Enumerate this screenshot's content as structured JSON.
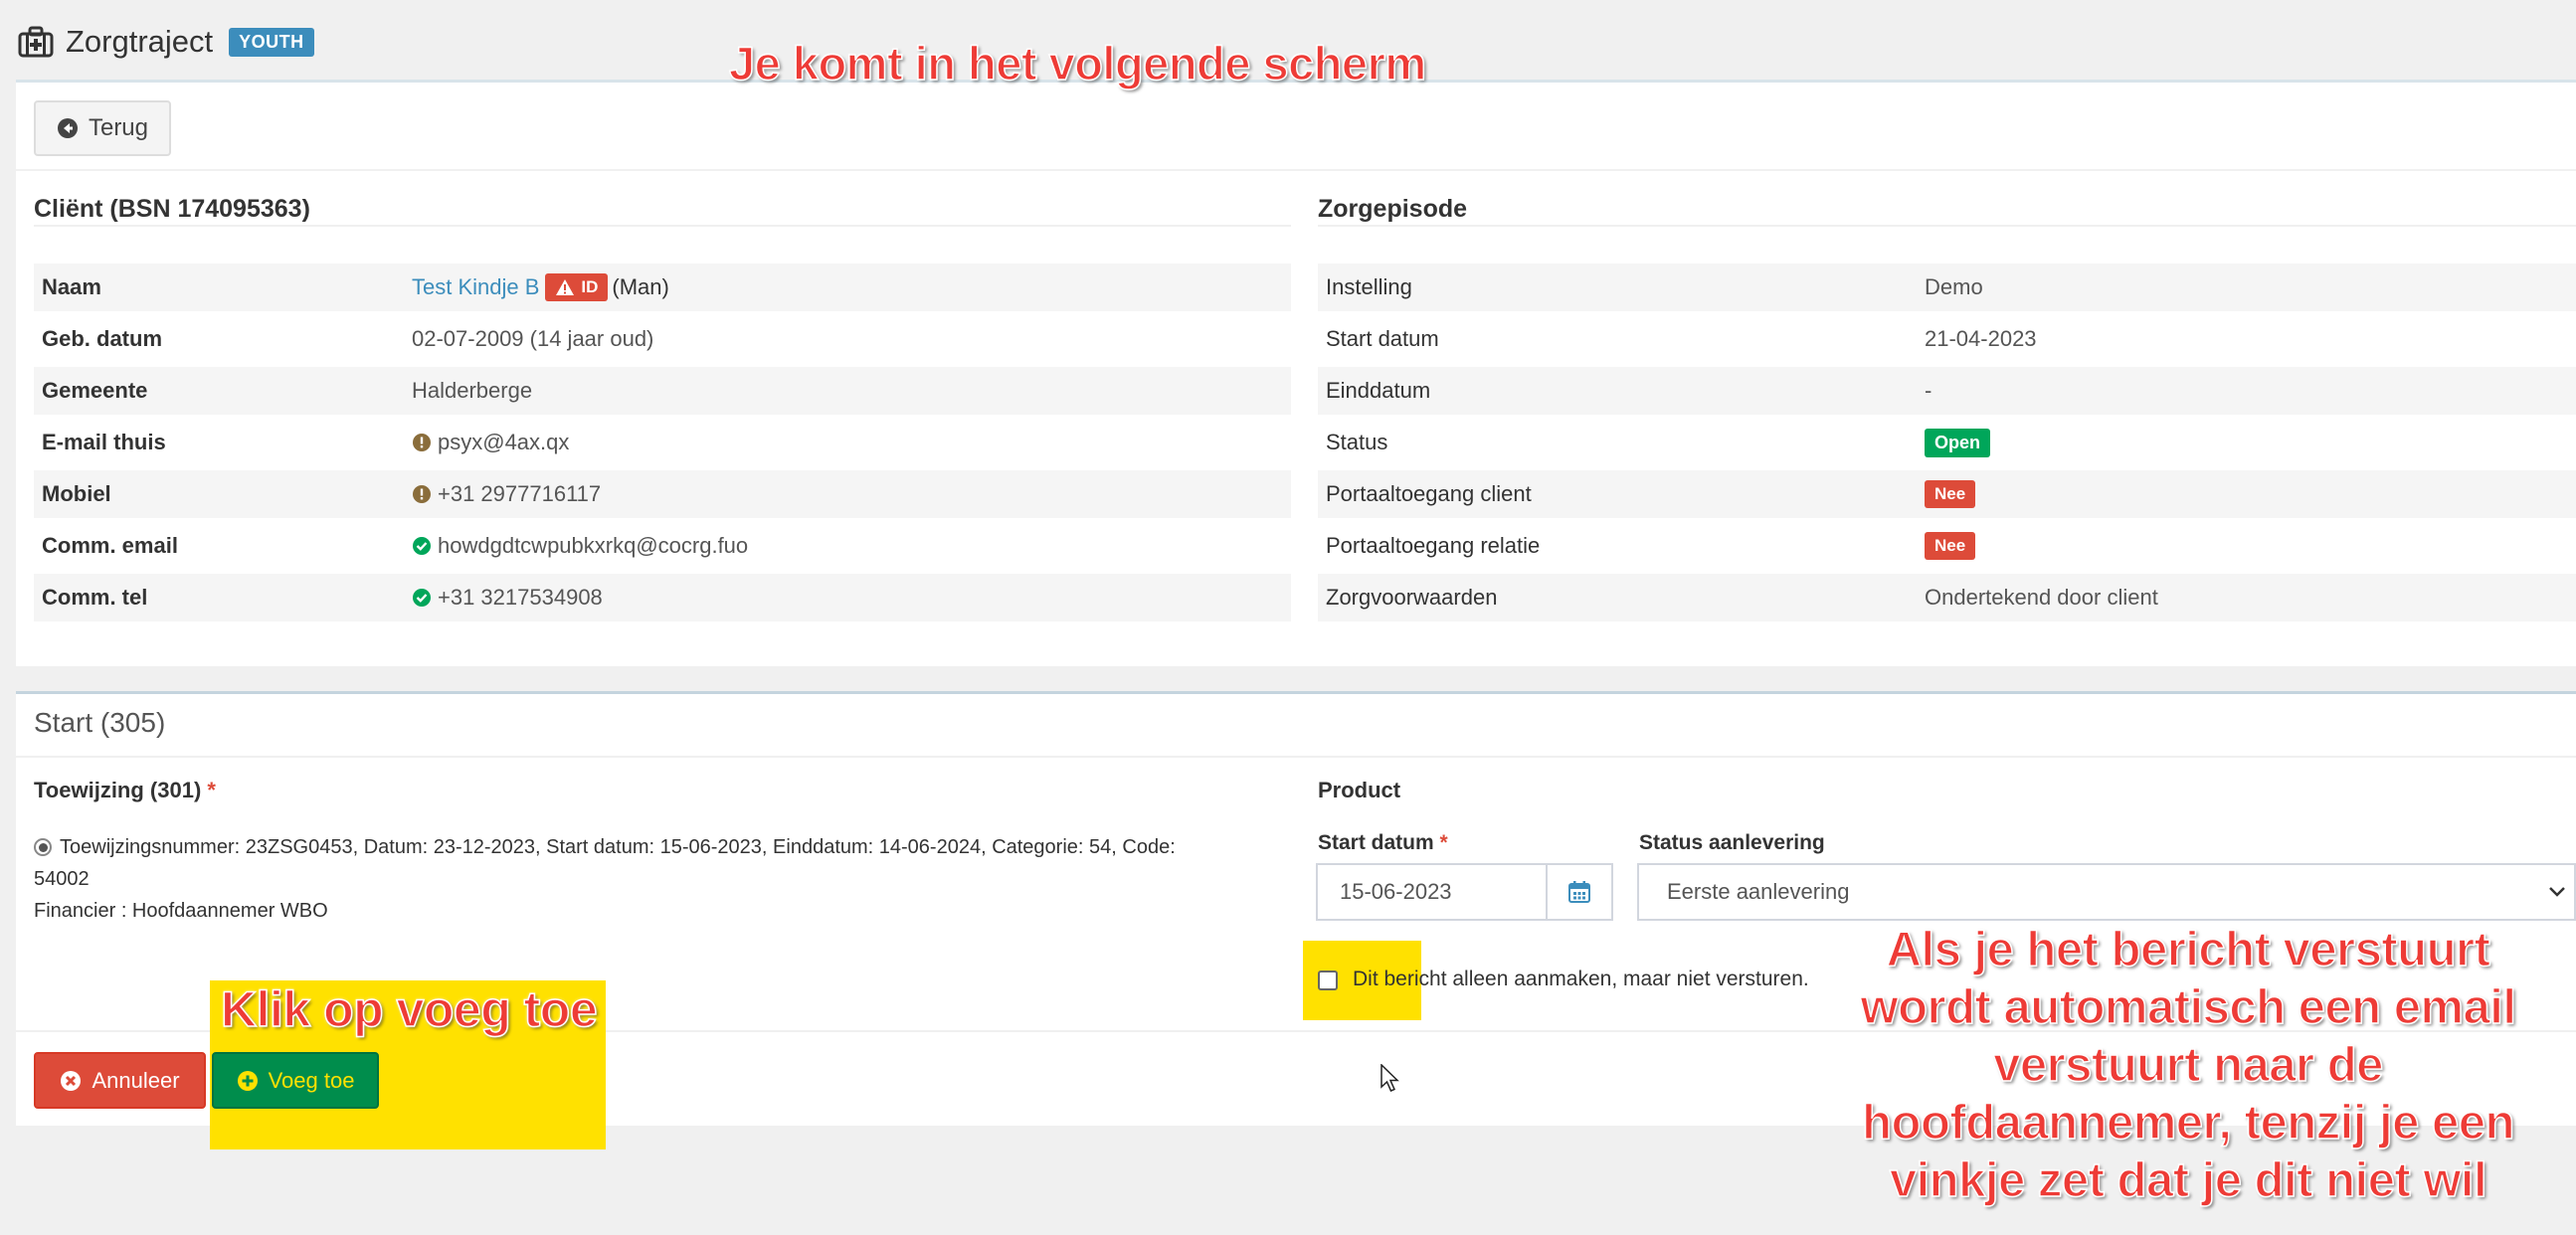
{
  "header": {
    "title": "Zorgtraject",
    "badge": "YOUTH"
  },
  "toolbar": {
    "back_label": "Terug"
  },
  "client": {
    "heading": "Cliënt (BSN 174095363)",
    "rows": [
      {
        "label": "Naam",
        "value": "Test Kindje B",
        "badge": "ID",
        "suffix": "(Man)"
      },
      {
        "label": "Geb. datum",
        "value": "02-07-2009 (14 jaar oud)"
      },
      {
        "label": "Gemeente",
        "value": "Halderberge"
      },
      {
        "label": "E-mail thuis",
        "value": "psyx@4ax.qx",
        "icon": "exclamation-circle-icon"
      },
      {
        "label": "Mobiel",
        "value": "+31 2977716117",
        "icon": "exclamation-circle-icon"
      },
      {
        "label": "Comm. email",
        "value": "howdgdtcwpubkxrkq@cocrg.fuo",
        "icon": "check-circle-icon"
      },
      {
        "label": "Comm. tel",
        "value": "+31 3217534908",
        "icon": "check-circle-icon"
      }
    ]
  },
  "episode": {
    "heading": "Zorgepisode",
    "rows": [
      {
        "label": "Instelling",
        "value": "Demo"
      },
      {
        "label": "Start datum",
        "value": "21-04-2023"
      },
      {
        "label": "Einddatum",
        "value": "-"
      },
      {
        "label": "Status",
        "value": "Open",
        "status_color": "#00a65a"
      },
      {
        "label": "Portaaltoegang client",
        "value": "Nee",
        "status_color": "#dd4b39"
      },
      {
        "label": "Portaaltoegang relatie",
        "value": "Nee",
        "status_color": "#dd4b39"
      },
      {
        "label": "Zorgvoorwaarden",
        "value": "Ondertekend door client"
      }
    ]
  },
  "start_form": {
    "title": "Start (305)",
    "toewijzing_label": "Toewijzing (301)",
    "required_mark": "*",
    "toewijzing_line1": "Toewijzingsnummer: 23ZSG0453, Datum: 23-12-2023, Start datum: 15-06-2023, Einddatum: 14-06-2024, Categorie: 54, Code:",
    "toewijzing_line2": "54002",
    "financier": "Financier : Hoofdaannemer WBO",
    "product_label": "Product",
    "start_datum_label": "Start datum",
    "start_datum_value": "15-06-2023",
    "status_label": "Status aanlevering",
    "status_value": "Eerste aanlevering",
    "checkbox_label": "Dit bericht alleen aanmaken, maar niet versturen.",
    "cancel_label": "Annuleer",
    "add_label": "Voeg toe"
  },
  "annotations": {
    "top": "Je komt in het volgende scherm",
    "button": "Klik op voeg toe",
    "info": [
      "Als je het bericht verstuurt",
      "wordt automatisch een email",
      "verstuurt naar de",
      "hoofdaannemer, tenzij je een",
      "vinkje zet dat je dit niet wil"
    ]
  },
  "colors": {
    "primary": "#3c8dbc",
    "danger": "#dd4b39",
    "success": "#00a65a",
    "highlight": "#ffe100",
    "annotation": "#ee3b36"
  }
}
